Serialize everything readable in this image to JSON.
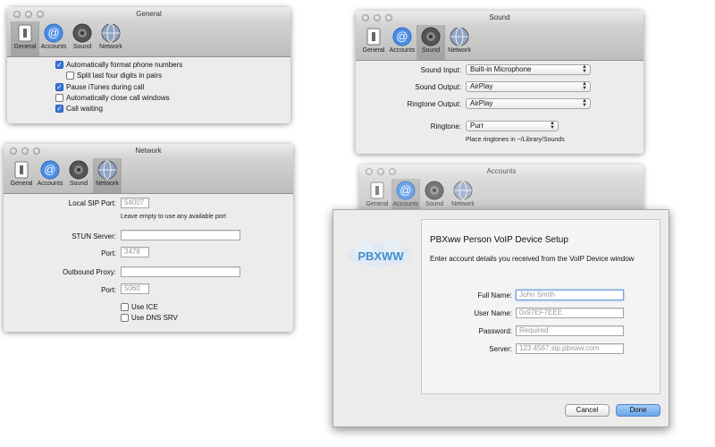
{
  "general": {
    "title": "General",
    "toolbar": [
      "General",
      "Accounts",
      "Sound",
      "Network"
    ],
    "options": [
      {
        "label": "Automatically format phone numbers",
        "checked": true
      },
      {
        "label": "Split last four digits in pairs",
        "checked": false
      },
      {
        "label": "Pause iTunes during call",
        "checked": true
      },
      {
        "label": "Automatically close call windows",
        "checked": false
      },
      {
        "label": "Call waiting",
        "checked": true
      }
    ]
  },
  "network": {
    "title": "Network",
    "toolbar": [
      "General",
      "Accounts",
      "Sound",
      "Network"
    ],
    "sip_label": "Local SIP Port:",
    "sip_value": "54007",
    "sip_note": "Leave empty to use any available port",
    "stun_label": "STUN Server:",
    "stun_value": "",
    "stun_port_label": "Port:",
    "stun_port_value": "3478",
    "proxy_label": "Outbound Proxy:",
    "proxy_value": "",
    "proxy_port_label": "Port:",
    "proxy_port_value": "5060",
    "use_ice": "Use ICE",
    "use_dns": "Use DNS SRV"
  },
  "sound": {
    "title": "Sound",
    "toolbar": [
      "General",
      "Accounts",
      "Sound",
      "Network"
    ],
    "input_label": "Sound Input:",
    "input_value": "Built-in Microphone",
    "output_label": "Sound Output:",
    "output_value": "AirPlay",
    "ringtone_output_label": "Ringtone Output:",
    "ringtone_output_value": "AirPlay",
    "ringtone_label": "Ringtone:",
    "ringtone_value": "Purr",
    "ringtone_note": "Place ringtones in ~/Library/Sounds"
  },
  "accounts": {
    "title": "Accounts",
    "toolbar": [
      "General",
      "Accounts",
      "Sound",
      "Network"
    ]
  },
  "sheet": {
    "logo_text": "PBXWW",
    "heading": "PBXww Person VoIP Device Setup",
    "subheading": "Enter account details you received from the VoIP Device window",
    "full_name_label": "Full Name:",
    "full_name_placeholder": "John Smith",
    "user_name_label": "User Name:",
    "user_name_placeholder": "0x97EF7EEE",
    "password_label": "Password:",
    "password_placeholder": "Required",
    "server_label": "Server:",
    "server_placeholder": "123.4567.sip.pbxww.com",
    "cancel": "Cancel",
    "done": "Done"
  },
  "colors": {
    "accent": "#3a74d8",
    "window": "#ececec"
  }
}
